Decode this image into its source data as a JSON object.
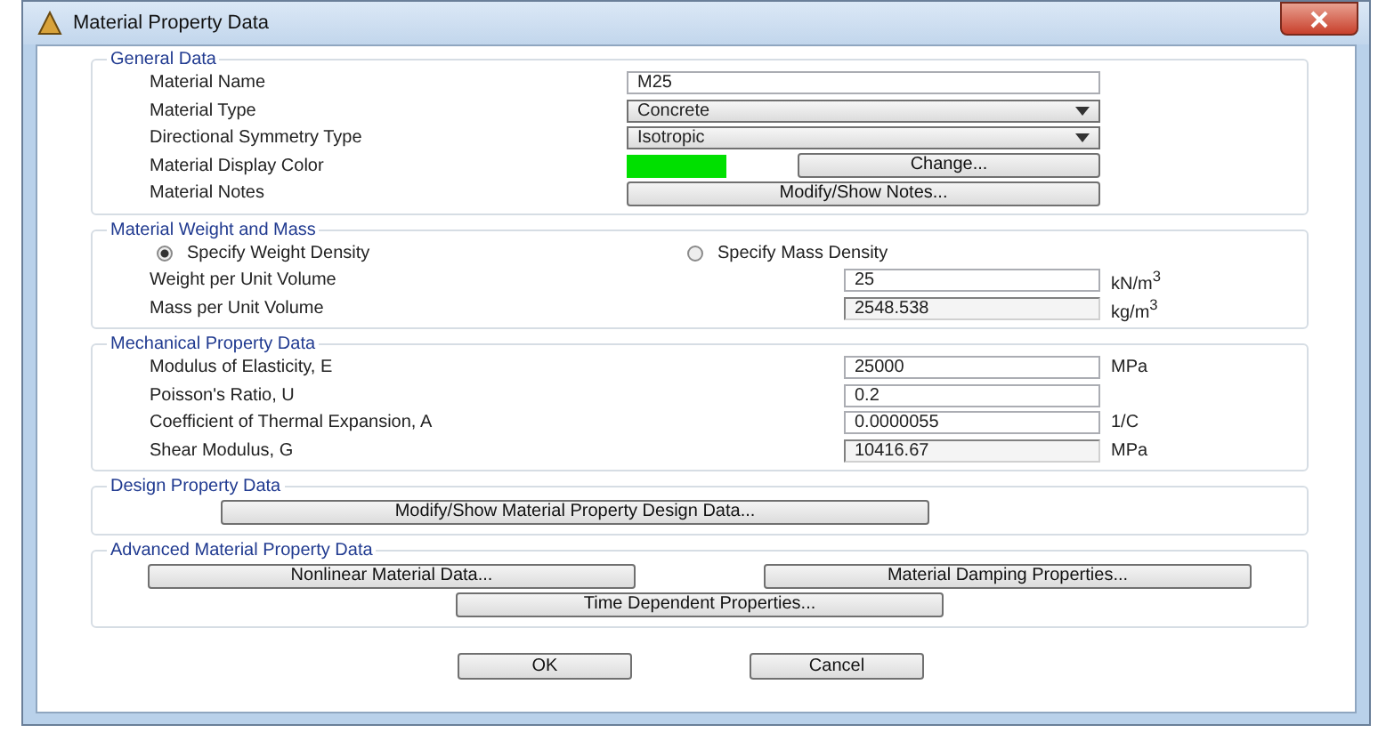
{
  "window": {
    "title": "Material Property Data"
  },
  "general_data": {
    "title": "General Data",
    "rows": [
      {
        "label": "Material Name",
        "kind": "text",
        "value": "M25"
      },
      {
        "label": "Material Type",
        "kind": "dropdown",
        "value": "Concrete"
      },
      {
        "label": "Directional Symmetry Type",
        "kind": "dropdown",
        "value": "Isotropic"
      },
      {
        "label": "Material Display Color",
        "kind": "color",
        "color": "#00e000",
        "button": "Change..."
      },
      {
        "label": "Material Notes",
        "kind": "button",
        "button": "Modify/Show Notes..."
      }
    ]
  },
  "weight_and_mass": {
    "title": "Material Weight and Mass",
    "options": [
      {
        "label": "Specify Weight Density",
        "selected": true
      },
      {
        "label": "Specify Mass Density",
        "selected": false
      }
    ],
    "rows": [
      {
        "label": "Weight per Unit Volume",
        "value": "25",
        "unit": "kN/m$^{3}$",
        "disabled": false
      },
      {
        "label": "Mass per Unit Volume",
        "value": "2548.538",
        "unit": "kg/m$^{3}$",
        "disabled": true
      }
    ]
  },
  "mechanical_data": {
    "title": "Mechanical Property Data",
    "rows": [
      {
        "label": "Modulus of Elasticity,  E",
        "value": "25000",
        "unit": "MPa",
        "disabled": false
      },
      {
        "label": "Poisson's Ratio,  U",
        "value": "0.2",
        "disabled": false
      },
      {
        "label": "Coefficient of Thermal Expansion,  A",
        "value": "0.0000055",
        "unit": "1/C",
        "disabled": false
      },
      {
        "label": "Shear Modulus,  G",
        "value": "10416.67",
        "unit": "MPa",
        "disabled": true
      }
    ]
  },
  "design_data": {
    "title": "Design Property Data",
    "button": "Modify/Show Material Property Design Data..."
  },
  "advanced_data": {
    "title": "Advanced Material Property Data",
    "buttons": [
      "Nonlinear Material Data...",
      "Material Damping Properties...",
      "Time Dependent Properties..."
    ]
  },
  "dialog_buttons": [
    "OK",
    "Cancel"
  ]
}
